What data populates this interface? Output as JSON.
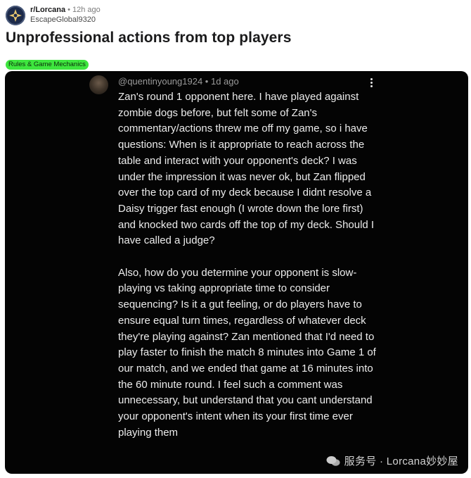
{
  "post": {
    "subreddit": "r/Lorcana",
    "separator": "•",
    "time_ago": "12h ago",
    "author": "EscapeGlobal9320",
    "title": "Unprofessional actions from top players",
    "flair": "Rules & Game Mechanics",
    "flair_color": "#3ee63e"
  },
  "image": {
    "comment_handle": "@quentinyoung1924 • 1d ago",
    "comment_paragraphs": [
      "Zan's round 1 opponent here. I have played against zombie dogs before, but felt some of Zan's commentary/actions threw me off my game, so i have questions: When is it appropriate to reach across the table and interact with your opponent's deck? I was under the impression it was never ok, but Zan flipped over the top card of my deck because I didnt resolve a Daisy trigger fast enough (I wrote down the lore first) and knocked two cards off the top of my deck. Should I have called a judge?",
      "Also, how do you determine your opponent is slow-playing vs taking appropriate time to consider sequencing? Is it a gut feeling, or do players have to ensure equal turn times, regardless of whatever deck they're playing against? Zan mentioned that I'd need to play faster to finish the match 8 minutes into Game 1 of our match, and we ended that game at 16 minutes into the 60 minute round. I feel such a comment was unnecessary, but understand that you cant understand your opponent's intent when its your first time ever playing them"
    ],
    "watermark": "服务号 · Lorcana妙妙屋"
  },
  "icons": {
    "subreddit_icon": "lorcana-emblem-icon",
    "comment_avatar": "user-avatar",
    "menu": "kebab-menu-icon",
    "watermark_icon": "wechat-icon"
  }
}
